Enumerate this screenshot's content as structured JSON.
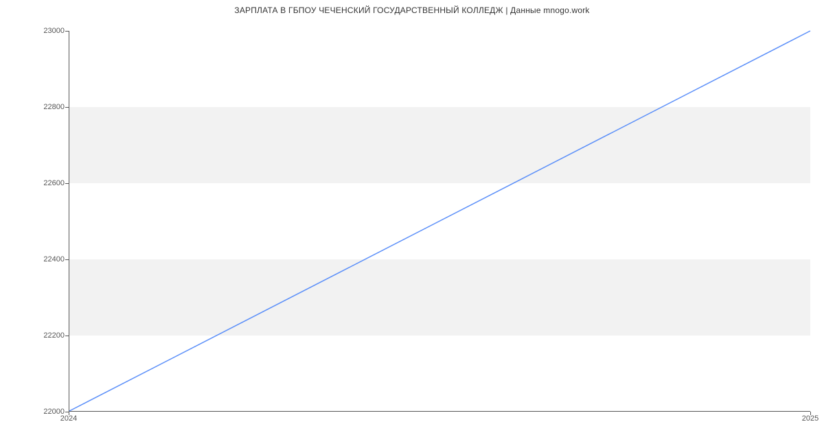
{
  "chart_data": {
    "type": "line",
    "title": "ЗАРПЛАТА В ГБПОУ ЧЕЧЕНСКИЙ ГОСУДАРСТВЕННЫЙ КОЛЛЕДЖ | Данные mnogo.work",
    "xlabel": "",
    "ylabel": "",
    "x_ticks": [
      "2024",
      "2025"
    ],
    "y_ticks": [
      22000,
      22200,
      22400,
      22600,
      22800,
      23000
    ],
    "ylim": [
      22000,
      23000
    ],
    "series": [
      {
        "name": "salary",
        "x": [
          "2024",
          "2025"
        ],
        "values": [
          22000,
          23000
        ]
      }
    ],
    "line_color": "#5b8ff9",
    "band_color": "#f2f2f2"
  }
}
